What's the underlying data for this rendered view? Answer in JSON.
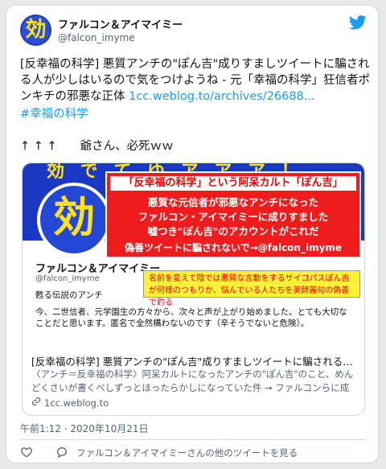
{
  "tweet": {
    "display_name": "ファルコン＆アイマイミー",
    "handle": "@falcon_imyme",
    "avatar_char": "効",
    "body_text": "[反幸福の科学] 悪質アンチの\"ぽん吉\"成りすましツイートに騙される人が少しはいるので気をつけようね - 元「幸福の科学」狂信者ポンキチの邪悪な正体 ",
    "body_link": "1cc.weblog.to/archives/26688...",
    "hashtag": "#幸福の科学",
    "reply_line": "↑ ↑ ↑　　爺さん、必死ｗｗ",
    "timestamp": "午前1:12 · 2020年10月21日",
    "more_tweets": "ファルコン＆アイマイミーさんの他のツイートを見る"
  },
  "link_card": {
    "image": {
      "banner_text": "効 で て ゆ ア ア ア ！",
      "avatar_char": "効",
      "red_line1": "「反幸福の科学」という阿呆カルト「ぽん吉」",
      "red_line2": "悪質な元信者が邪悪なアンチになった",
      "red_line3": "ファルコン・アイマイミーに成りすました",
      "red_line4": "嘘つき\"ぽん吉\"のアカウントがこれだ",
      "red_line5": "偽善ツイートに騙されないで→@falcon_imyme",
      "profile_name": "ファルコン＆アイマイミー",
      "profile_handle": "@falcon_imyme",
      "profile_bio": "甦る伝説のアンチ",
      "yellow_note": "名前を変えて陰では悪質な言動をするサイコパスぽん吉が何様のつもりか、悩んでいる人たちを美辞麗句の偽善で釣る",
      "profile_body": "今、二世信者、元学園生の方々から、次々と声が上がり始めました。とても大切なことだと思います。匿名で全然構わないのです（辛そうでないと危険）。"
    },
    "title": "[反幸福の科学] 悪質アンチの\"ぽん吉\"成りすましツイートに騙される人が少しはいる...",
    "description": "〈アンチ＝反幸福の科学〉阿呆カルトになったアンチの\"ぽん吉\"のこと、めんどくさいが書くべしずっとほったらかしになっていた件 → ファルコンらに成りすました\"ぽん吉\"爺さ...",
    "domain": "1cc.weblog.to"
  },
  "colors": {
    "accent": "#1d9bf0",
    "banner_blue": "#1b38c4",
    "red": "#ee1c1c",
    "yellow": "#ffe21a"
  },
  "icons": [
    "twitter-bird-icon",
    "heart-icon",
    "reply-bubble-icon",
    "link-chain-icon"
  ]
}
